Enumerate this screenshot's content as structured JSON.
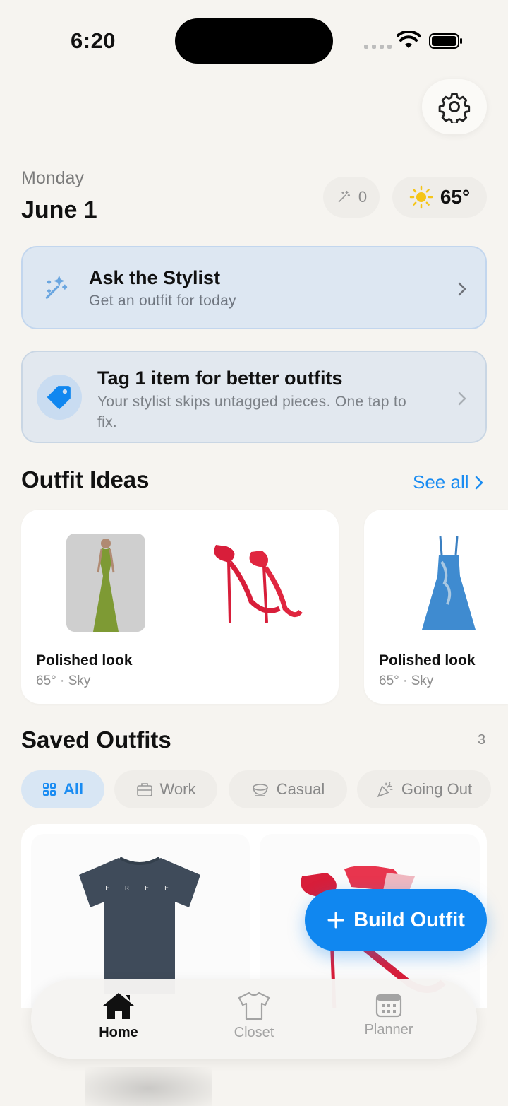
{
  "status_bar": {
    "time": "6:20"
  },
  "header": {
    "weekday": "Monday",
    "date": "June 1",
    "magic_count": "0",
    "temperature": "65°"
  },
  "stylist_card": {
    "title": "Ask the Stylist",
    "subtitle": "Get an outfit for today"
  },
  "tag_card": {
    "title": "Tag 1 item for better outfits",
    "subtitle": "Your stylist skips untagged pieces. One tap to fix."
  },
  "outfit_ideas": {
    "title": "Outfit Ideas",
    "see_all": "See all",
    "items": [
      {
        "name": "Polished look",
        "meta": "65° · Sky"
      },
      {
        "name": "Polished look",
        "meta": "65° · Sky"
      }
    ]
  },
  "saved_outfits": {
    "title": "Saved Outfits",
    "count": "3",
    "filters": [
      "All",
      "Work",
      "Casual",
      "Going Out"
    ],
    "shirt_text": "F R E E"
  },
  "fab": {
    "label": "Build Outfit"
  },
  "tabbar": {
    "items": [
      "Home",
      "Closet",
      "Planner"
    ]
  },
  "colors": {
    "accent": "#1087f0",
    "background": "#f6f4f0",
    "stylist_card": "#dde7f2"
  }
}
